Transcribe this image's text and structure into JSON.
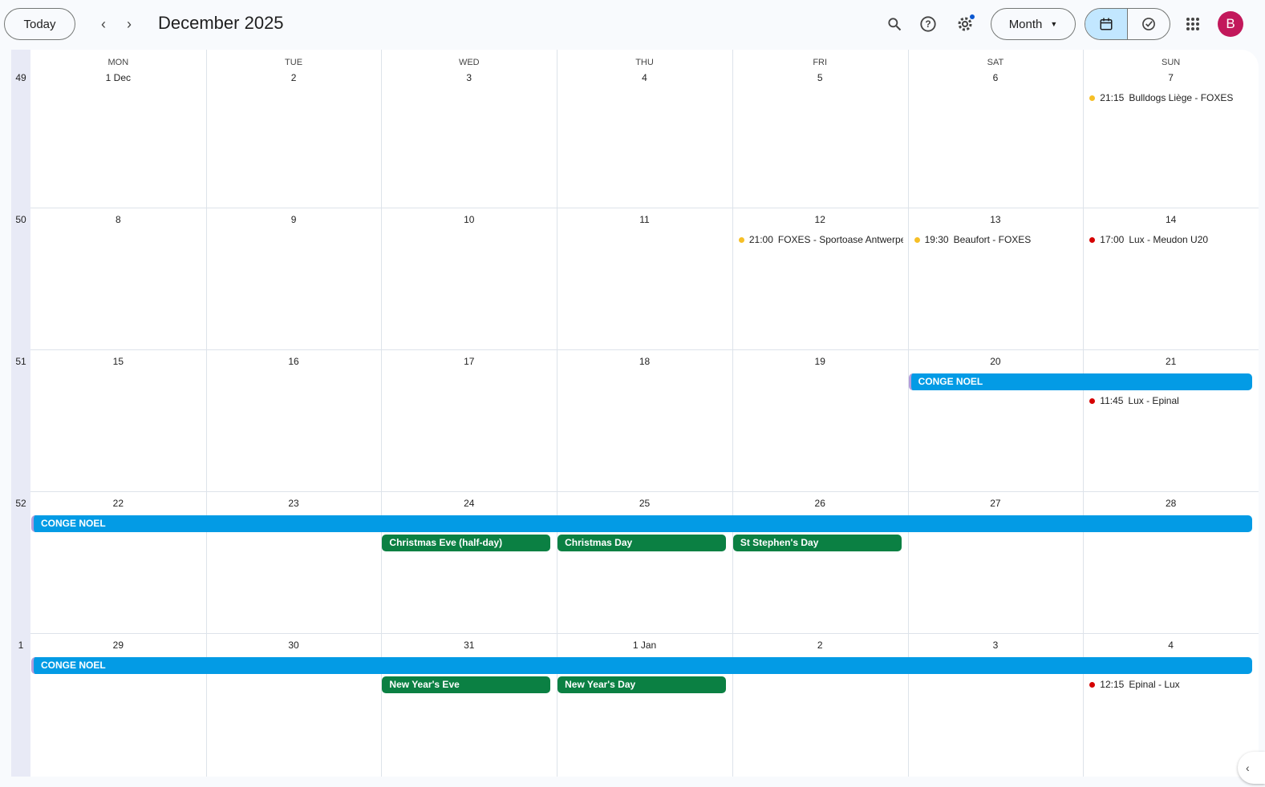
{
  "header": {
    "today_label": "Today",
    "title": "December 2025",
    "view_label": "Month",
    "avatar_letter": "B"
  },
  "colors": {
    "accent_blue": "#039be5",
    "holiday_green": "#0b8043",
    "dot_yellow": "#f6bf26",
    "dot_red": "#d50000"
  },
  "days_of_week": [
    "MON",
    "TUE",
    "WED",
    "THU",
    "FRI",
    "SAT",
    "SUN"
  ],
  "weeks": [
    {
      "number": "49",
      "days": [
        "1 Dec",
        "2",
        "3",
        "4",
        "5",
        "6",
        "7"
      ],
      "spans": [],
      "events": [
        {
          "col": 6,
          "slot": 0,
          "time": "21:15",
          "title": "Bulldogs Liège - FOXES",
          "color": "#f6bf26"
        }
      ]
    },
    {
      "number": "50",
      "days": [
        "8",
        "9",
        "10",
        "11",
        "12",
        "13",
        "14"
      ],
      "spans": [],
      "events": [
        {
          "col": 4,
          "slot": 0,
          "time": "21:00",
          "title": "FOXES - Sportoase Antwerpen",
          "color": "#f6bf26"
        },
        {
          "col": 5,
          "slot": 0,
          "time": "19:30",
          "title": "Beaufort - FOXES",
          "color": "#f6bf26"
        },
        {
          "col": 6,
          "slot": 0,
          "time": "17:00",
          "title": "Lux - Meudon U20",
          "color": "#d50000"
        }
      ]
    },
    {
      "number": "51",
      "days": [
        "15",
        "16",
        "17",
        "18",
        "19",
        "20",
        "21"
      ],
      "spans": [
        {
          "start": 5,
          "end": 6,
          "slot": 0,
          "title": "CONGE NOEL",
          "kind": "blue"
        }
      ],
      "events": [
        {
          "col": 6,
          "slot": 1,
          "time": "11:45",
          "title": "Lux - Epinal",
          "color": "#d50000"
        }
      ]
    },
    {
      "number": "52",
      "days": [
        "22",
        "23",
        "24",
        "25",
        "26",
        "27",
        "28"
      ],
      "spans": [
        {
          "start": 0,
          "end": 6,
          "slot": 0,
          "title": "CONGE NOEL",
          "kind": "blue"
        },
        {
          "start": 2,
          "end": 2,
          "slot": 1,
          "title": "Christmas Eve (half-day)",
          "kind": "green"
        },
        {
          "start": 3,
          "end": 3,
          "slot": 1,
          "title": "Christmas Day",
          "kind": "green"
        },
        {
          "start": 4,
          "end": 4,
          "slot": 1,
          "title": "St Stephen's Day",
          "kind": "green"
        }
      ],
      "events": []
    },
    {
      "number": "1",
      "days": [
        "29",
        "30",
        "31",
        "1 Jan",
        "2",
        "3",
        "4"
      ],
      "spans": [
        {
          "start": 0,
          "end": 6,
          "slot": 0,
          "title": "CONGE NOEL",
          "kind": "blue"
        },
        {
          "start": 2,
          "end": 2,
          "slot": 1,
          "title": "New Year's Eve",
          "kind": "green"
        },
        {
          "start": 3,
          "end": 3,
          "slot": 1,
          "title": "New Year's Day",
          "kind": "green"
        }
      ],
      "events": [
        {
          "col": 6,
          "slot": 1,
          "time": "12:15",
          "title": "Epinal - Lux",
          "color": "#d50000"
        }
      ]
    }
  ]
}
